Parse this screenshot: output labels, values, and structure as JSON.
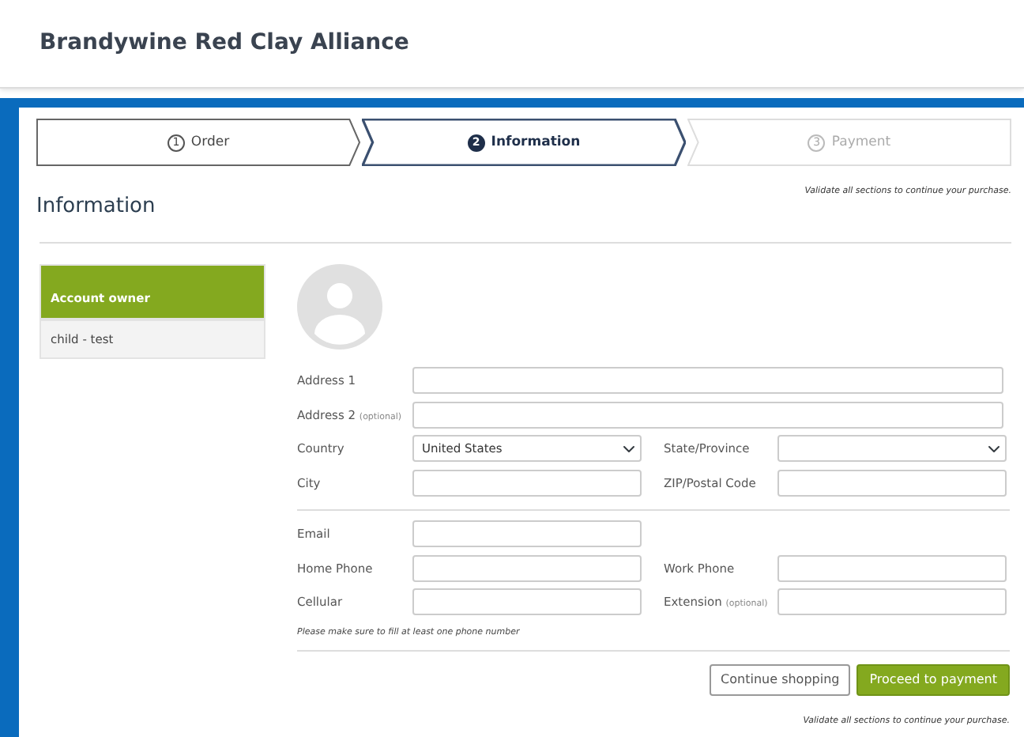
{
  "header": {
    "title": "Brandywine Red Clay Alliance"
  },
  "steps": [
    {
      "number": "1",
      "label": "Order",
      "selected": false,
      "disabled": false
    },
    {
      "number": "2",
      "label": "Information",
      "selected": true,
      "disabled": false
    },
    {
      "number": "3",
      "label": "Payment",
      "selected": false,
      "disabled": true
    }
  ],
  "validate_note_top": "Validate all sections to continue your purchase.",
  "heading": "Information",
  "sidebar": {
    "items": [
      {
        "label": "Account owner",
        "selected": true
      },
      {
        "label": "child - test",
        "selected": false
      }
    ]
  },
  "address_rows": [
    [
      {
        "label": "Address 1",
        "kind": "text",
        "wide": true
      }
    ],
    [
      {
        "label": "Address 2",
        "optional": "(optional)",
        "kind": "text",
        "wide": true
      }
    ],
    [
      {
        "label": "Country",
        "kind": "select",
        "value": "United States"
      },
      {
        "label": "State/Province",
        "kind": "select"
      }
    ],
    [
      {
        "label": "City",
        "kind": "text"
      },
      {
        "label": "ZIP/Postal Code",
        "kind": "text"
      }
    ]
  ],
  "contact_rows": [
    [
      {
        "label": "Email",
        "kind": "text"
      }
    ],
    [
      {
        "label": "Home Phone",
        "kind": "text"
      },
      {
        "label": "Work Phone",
        "kind": "text"
      }
    ],
    [
      {
        "label": "Cellular",
        "kind": "text"
      },
      {
        "label": "Extension",
        "optional": "(optional)",
        "kind": "text"
      }
    ]
  ],
  "phone_note": "Please make sure to fill at least one phone number",
  "buttons": [
    {
      "label": "Continue shopping",
      "kind": "secondary"
    },
    {
      "label": "Proceed to payment",
      "kind": "primary"
    }
  ],
  "validate_note_bottom": "Validate all sections to continue your purchase."
}
